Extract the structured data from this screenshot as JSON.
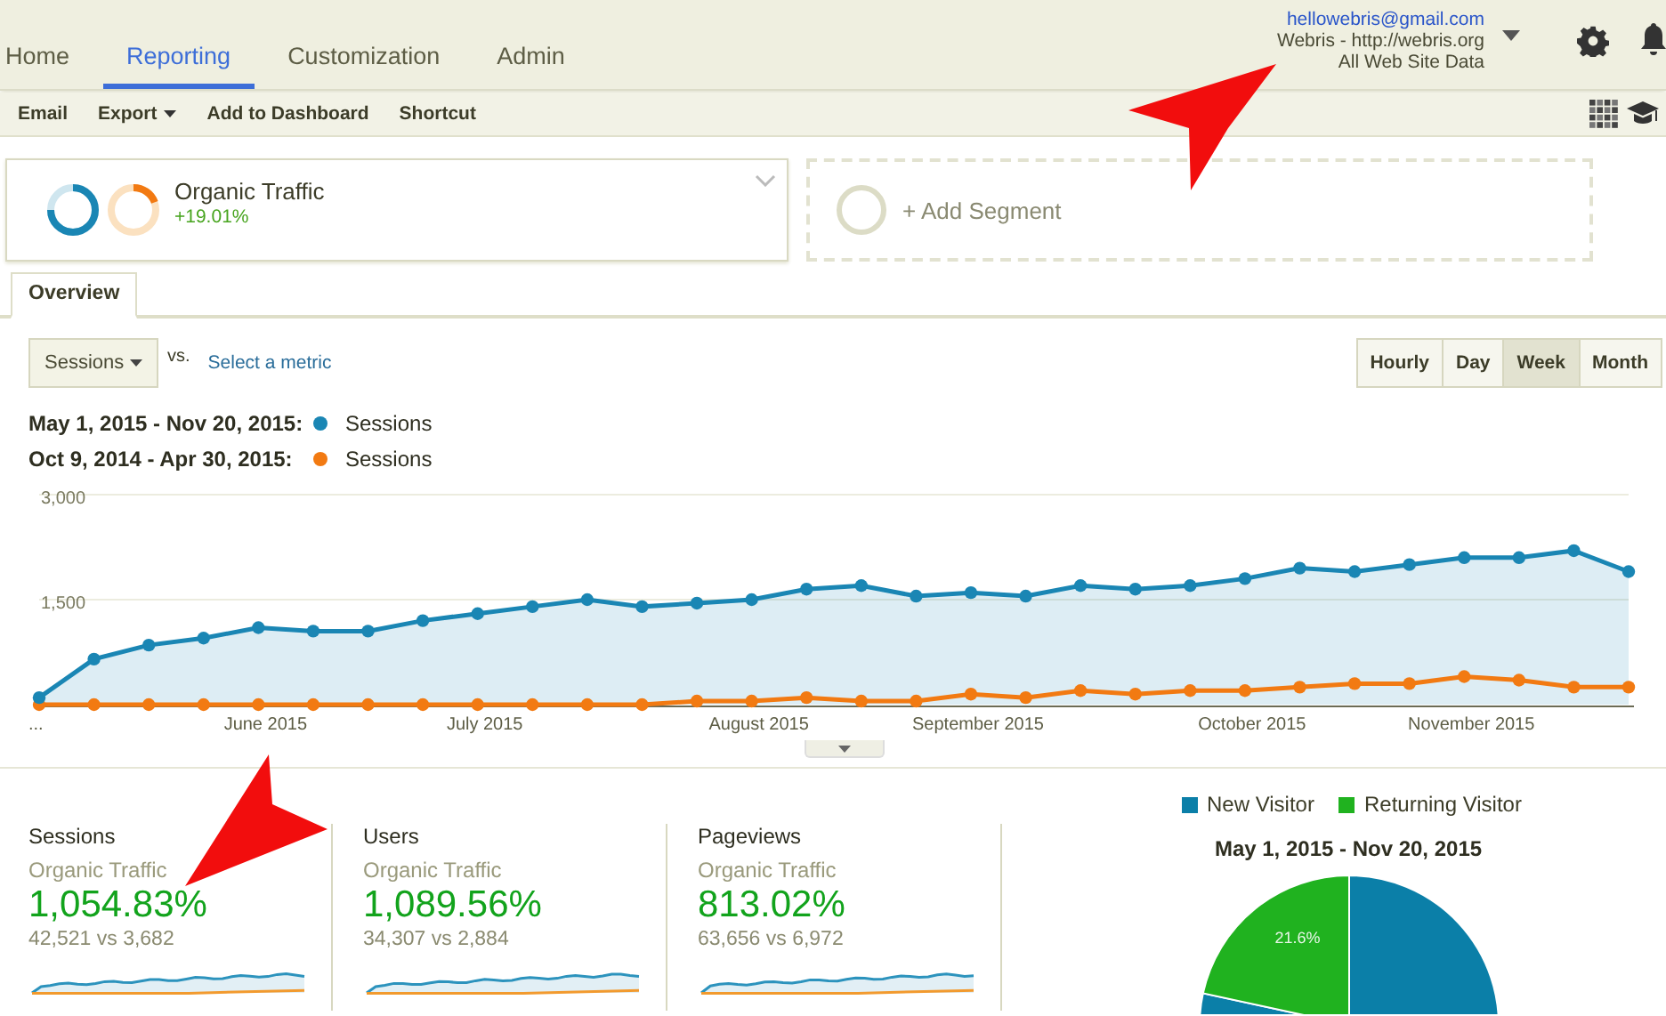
{
  "top_nav": {
    "tabs": [
      {
        "label": "Home",
        "selected": false
      },
      {
        "label": "Reporting",
        "selected": true
      },
      {
        "label": "Customization",
        "selected": false
      },
      {
        "label": "Admin",
        "selected": false
      }
    ]
  },
  "account": {
    "email": "hellowebris@gmail.com",
    "property": "Webris - http://webris.org",
    "view": "All Web Site Data"
  },
  "toolbar": {
    "items": [
      {
        "label": "Email",
        "kind": "plain"
      },
      {
        "label": "Export",
        "kind": "menu"
      },
      {
        "label": "Add to Dashboard",
        "kind": "plain"
      },
      {
        "label": "Shortcut",
        "kind": "plain"
      }
    ]
  },
  "segments": [
    {
      "kind": "segment",
      "name": "Organic Traffic",
      "change": "+19.01%"
    },
    {
      "kind": "add",
      "name": "+ Add Segment"
    }
  ],
  "view_tabs": [
    {
      "label": "Overview",
      "selected": true
    }
  ],
  "metric_select": {
    "value": "Sessions"
  },
  "vs_label": "vs.",
  "select_metric": "Select a metric",
  "granularity": [
    {
      "label": "Hourly",
      "selected": false
    },
    {
      "label": "Day",
      "selected": false
    },
    {
      "label": "Week",
      "selected": true
    },
    {
      "label": "Month",
      "selected": false
    }
  ],
  "legend": [
    {
      "range": "May 1, 2015 - Nov 20, 2015:"
    },
    {
      "range": "Oct 9, 2014 - Apr 30, 2015:"
    }
  ],
  "chart_data": {
    "type": "line",
    "categories": [
      "...",
      null,
      null,
      null,
      "June 2015",
      null,
      null,
      null,
      "July 2015",
      null,
      null,
      null,
      null,
      "August 2015",
      null,
      null,
      null,
      "September 2015",
      null,
      null,
      null,
      null,
      "October 2015",
      null,
      null,
      null,
      "November 2015",
      null,
      null,
      null
    ],
    "ylim": [
      0,
      3000
    ],
    "yticks": [
      {
        "value": 1500,
        "label": "1,500"
      },
      {
        "value": 3000,
        "label": "3,000"
      }
    ],
    "series": [
      {
        "name": "Sessions",
        "type": "area",
        "marker": "circle",
        "color": "#1a86b4",
        "values": [
          100,
          650,
          850,
          950,
          1100,
          1050,
          1050,
          1200,
          1300,
          1400,
          1500,
          1400,
          1450,
          1500,
          1650,
          1700,
          1550,
          1600,
          1550,
          1700,
          1650,
          1700,
          1800,
          1950,
          1900,
          2000,
          2100,
          2100,
          2200,
          1900
        ]
      },
      {
        "name": "Sessions",
        "type": "line",
        "marker": "circle",
        "color": "#f27a12",
        "values": [
          0,
          0,
          0,
          0,
          0,
          0,
          0,
          0,
          0,
          0,
          0,
          0,
          50,
          50,
          100,
          50,
          50,
          150,
          100,
          200,
          150,
          200,
          200,
          250,
          300,
          300,
          400,
          350,
          250,
          250
        ]
      }
    ]
  },
  "scorecards": [
    {
      "title": "Sessions",
      "segment": "Organic Traffic",
      "change": "1,054.83%",
      "comparison": "42,521 vs 3,682"
    },
    {
      "title": "Users",
      "segment": "Organic Traffic",
      "change": "1,089.56%",
      "comparison": "34,307 vs 2,884"
    },
    {
      "title": "Pageviews",
      "segment": "Organic Traffic",
      "change": "813.02%",
      "comparison": "63,656 vs 6,972"
    }
  ],
  "pie": {
    "chart_data": {
      "type": "pie",
      "title": "May 1, 2015 - Nov 20, 2015",
      "categories": [
        "New Visitor",
        "Returning Visitor"
      ],
      "colors": [
        "#0b7fa8",
        "#20b21f"
      ],
      "values": [
        78.4,
        21.6
      ],
      "value_labels": [
        null,
        "21.6%"
      ]
    }
  }
}
